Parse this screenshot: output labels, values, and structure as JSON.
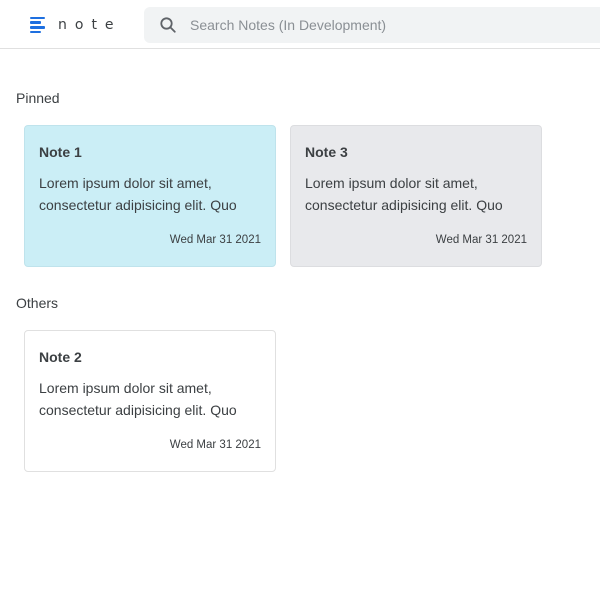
{
  "header": {
    "logo_text": "note",
    "search_placeholder": "Search Notes (In Development)"
  },
  "sections": {
    "pinned": {
      "title": "Pinned",
      "notes": [
        {
          "title": "Note 1",
          "body": "Lorem ipsum dolor sit amet, consectetur adipisicing elit. Quo",
          "date": "Wed Mar 31 2021",
          "color": "#cbeef6"
        },
        {
          "title": "Note 3",
          "body": "Lorem ipsum dolor sit amet, consectetur adipisicing elit. Quo",
          "date": "Wed Mar 31 2021",
          "color": "#e8e9ec"
        }
      ]
    },
    "others": {
      "title": "Others",
      "notes": [
        {
          "title": "Note 2",
          "body": "Lorem ipsum dolor sit amet, consectetur adipisicing elit. Quo",
          "date": "Wed Mar 31 2021",
          "color": "#ffffff"
        }
      ]
    }
  },
  "icons": {
    "menu": "menu-icon",
    "search": "search-icon"
  },
  "colors": {
    "accent": "#1e6fe0",
    "search_bg": "#f1f3f4"
  }
}
